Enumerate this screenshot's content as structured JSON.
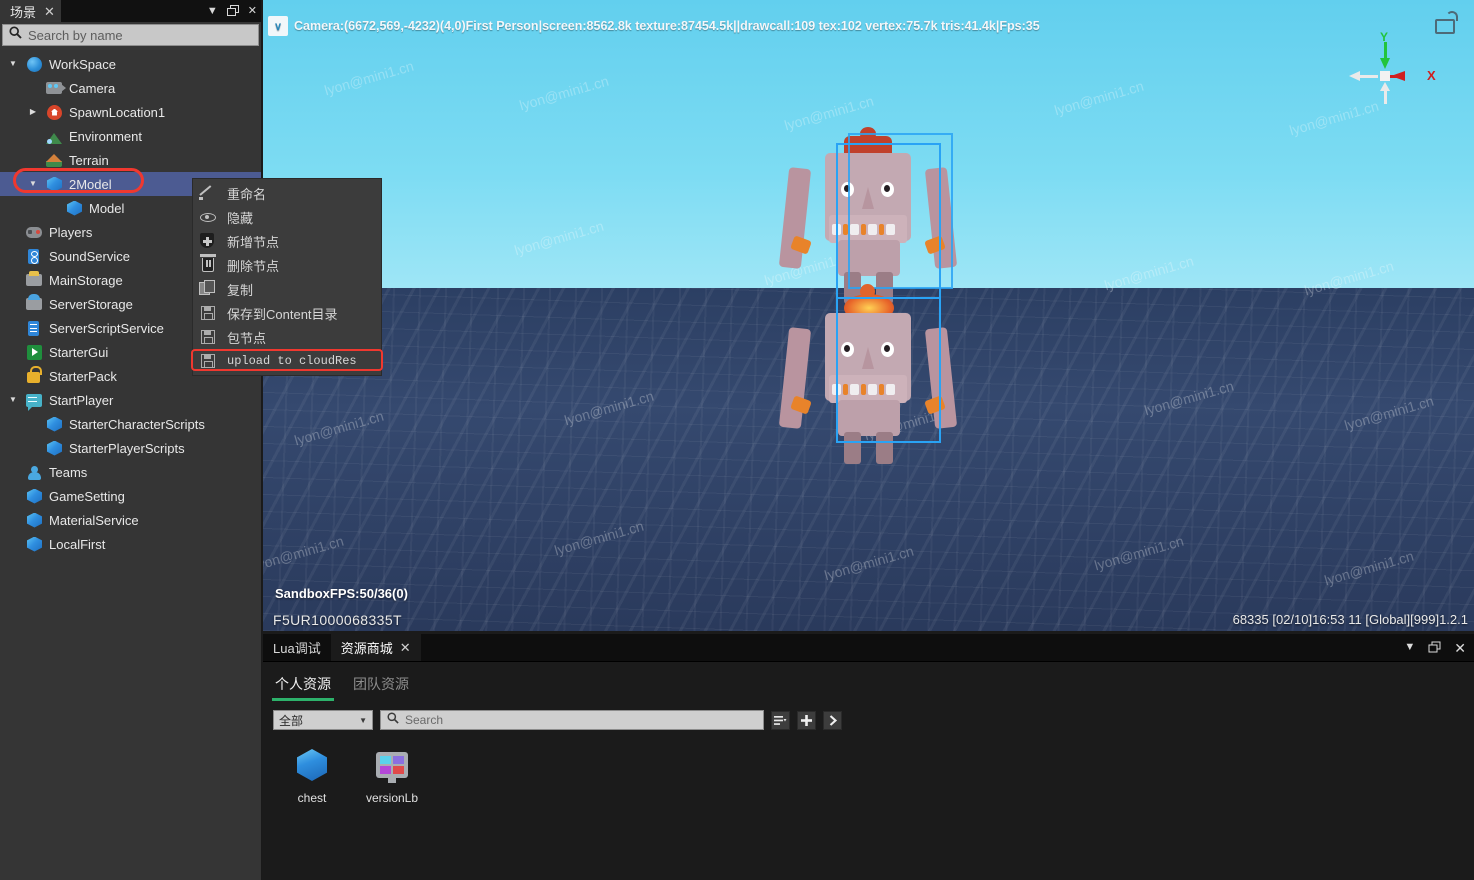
{
  "scene_panel": {
    "tab_label": "场景",
    "tab_close": "✕",
    "controls": {
      "dropdown": "▼",
      "restore": "restore-icon",
      "close": "✕"
    },
    "search": {
      "placeholder": "Search by name",
      "value": "",
      "icon": "search-icon"
    },
    "tree": [
      {
        "label": "WorkSpace",
        "icon": "globe-icon",
        "indent": 0,
        "twisty": "▼",
        "selected": false
      },
      {
        "label": "Camera",
        "icon": "camera-icon",
        "indent": 1,
        "twisty": "",
        "selected": false
      },
      {
        "label": "SpawnLocation1",
        "icon": "spawn-pin-icon",
        "indent": 1,
        "twisty": "▶",
        "selected": false
      },
      {
        "label": "Environment",
        "icon": "environment-icon",
        "indent": 1,
        "twisty": "",
        "selected": false
      },
      {
        "label": "Terrain",
        "icon": "terrain-icon",
        "indent": 1,
        "twisty": "",
        "selected": false
      },
      {
        "label": "2Model",
        "icon": "cube-icon",
        "indent": 1,
        "twisty": "▼",
        "selected": true
      },
      {
        "label": "Model",
        "icon": "cube-icon",
        "indent": 2,
        "twisty": "",
        "selected": false
      },
      {
        "label": "Players",
        "icon": "gamepad-icon",
        "indent": 0,
        "twisty": "",
        "selected": false
      },
      {
        "label": "SoundService",
        "icon": "sound-icon",
        "indent": 0,
        "twisty": "",
        "selected": false
      },
      {
        "label": "MainStorage",
        "icon": "storage-icon",
        "indent": 0,
        "twisty": "",
        "selected": false
      },
      {
        "label": "ServerStorage",
        "icon": "server-storage-icon",
        "indent": 0,
        "twisty": "",
        "selected": false
      },
      {
        "label": "ServerScriptService",
        "icon": "server-icon",
        "indent": 0,
        "twisty": "",
        "selected": false
      },
      {
        "label": "StarterGui",
        "icon": "play-icon",
        "indent": 0,
        "twisty": "",
        "selected": false
      },
      {
        "label": "StarterPack",
        "icon": "lock-icon",
        "indent": 0,
        "twisty": "",
        "selected": false
      },
      {
        "label": "StartPlayer",
        "icon": "screen-icon",
        "indent": 0,
        "twisty": "▼",
        "selected": false
      },
      {
        "label": "StarterCharacterScripts",
        "icon": "cube-icon",
        "indent": 1,
        "twisty": "",
        "selected": false
      },
      {
        "label": "StarterPlayerScripts",
        "icon": "cube-icon",
        "indent": 1,
        "twisty": "",
        "selected": false
      },
      {
        "label": "Teams",
        "icon": "team-icon",
        "indent": 0,
        "twisty": "",
        "selected": false
      },
      {
        "label": "GameSetting",
        "icon": "cube-icon",
        "indent": 0,
        "twisty": "",
        "selected": false
      },
      {
        "label": "MaterialService",
        "icon": "cube-icon",
        "indent": 0,
        "twisty": "",
        "selected": false
      },
      {
        "label": "LocalFirst",
        "icon": "cube-icon",
        "indent": 0,
        "twisty": "",
        "selected": false
      }
    ]
  },
  "context_menu": {
    "items": [
      {
        "label": "重命名",
        "icon": "pencil-icon",
        "highlighted": false,
        "mono": false
      },
      {
        "label": "隐藏",
        "icon": "eye-icon",
        "highlighted": false,
        "mono": false
      },
      {
        "label": "新增节点",
        "icon": "add-node-icon",
        "highlighted": false,
        "mono": false
      },
      {
        "label": "删除节点",
        "icon": "trash-icon",
        "highlighted": false,
        "mono": false
      },
      {
        "label": "复制",
        "icon": "copy-icon",
        "highlighted": false,
        "mono": false
      },
      {
        "label": "保存到Content目录",
        "icon": "save-icon",
        "highlighted": false,
        "mono": false
      },
      {
        "label": "包节点",
        "icon": "save-icon",
        "highlighted": false,
        "mono": false
      },
      {
        "label": "upload to cloudRes",
        "icon": "save-icon",
        "highlighted": true,
        "mono": true
      }
    ],
    "highlight_color": "#f0382f"
  },
  "viewport": {
    "camera_bar": "Camera:(6672,569,-4232)(4,0)First Person|screen:8562.8k texture:87454.5k||drawcall:109 tex:102 vertex:75.7k tris:41.4k|Fps:35",
    "camera_bar_chevron": "∨",
    "gizmo": {
      "x_label": "X",
      "y_label": "Y",
      "x_color": "#cf1f1f",
      "y_color": "#22c43c"
    },
    "lock_icon": "unlock-icon",
    "fps_text": "SandboxFPS:50/36(0)",
    "uid_text": "F5UR1000068335T",
    "meta_text": "68335   [02/10]16:53 11 [Global][999]1.2.1",
    "watermark": "lyon@mini1.cn",
    "selection_color": "#29a3f5"
  },
  "bottom_panel": {
    "tabs": [
      {
        "label": "Lua调试",
        "active": false,
        "closable": false
      },
      {
        "label": "资源商城",
        "active": true,
        "closable": true,
        "close": "✕"
      }
    ],
    "controls": {
      "dropdown": "▼",
      "restore": "restore-icon",
      "close": "✕"
    },
    "subtabs": [
      {
        "label": "个人资源",
        "active": true
      },
      {
        "label": "团队资源",
        "active": false
      }
    ],
    "accent_color": "#2db26b",
    "filter": {
      "value": "全部",
      "caret": "▼"
    },
    "search": {
      "placeholder": "Search",
      "value": "",
      "icon": "search-icon"
    },
    "toolbar_buttons": [
      {
        "name": "view-list-button",
        "glyph": "≡"
      },
      {
        "name": "add-button",
        "glyph": "✚"
      },
      {
        "name": "next-button",
        "glyph": "❯"
      }
    ],
    "assets": [
      {
        "name": "chest",
        "icon": "cube-icon"
      },
      {
        "name": "versionLb",
        "icon": "screen-icon"
      }
    ]
  }
}
